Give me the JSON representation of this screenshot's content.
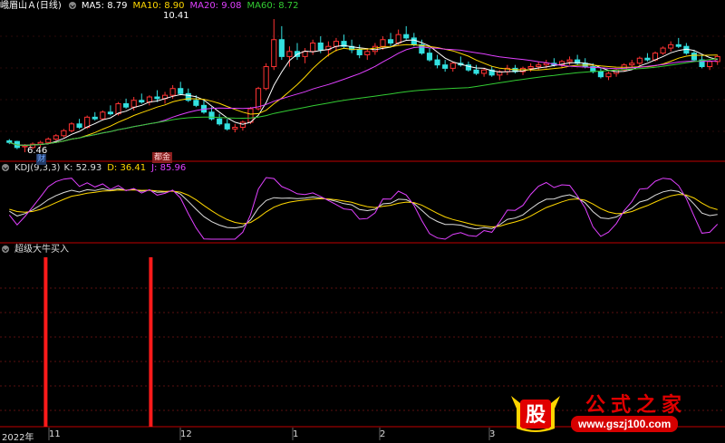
{
  "stock": {
    "name": "峨眉山Ａ(日线)"
  },
  "ma_legend": [
    {
      "label": "MA5: 8.79",
      "color": "#ffffff"
    },
    {
      "label": "MA10: 8.90",
      "color": "#ffd700"
    },
    {
      "label": "MA20: 9.08",
      "color": "#e040ff"
    },
    {
      "label": "MA60: 8.72",
      "color": "#33cc33"
    }
  ],
  "kdj_legend": {
    "label": "KDJ(9,3,3)",
    "k": "K: 52.93",
    "k_color": "#dddddd",
    "d": "D: 36.41",
    "d_color": "#ffd700",
    "j": "J: 85.96",
    "j_color": "#e040ff"
  },
  "signal_panel": {
    "label": "超级大牛买入"
  },
  "annotations": {
    "high": "10.41",
    "low": "6.46",
    "low_tag": "财",
    "event_tag": "都金"
  },
  "timeline": {
    "year": "2022年",
    "ticks": [
      "11",
      "12",
      "1",
      "2",
      "3"
    ]
  },
  "watermark": {
    "badge": "股",
    "title": "公式之家",
    "url": "www.gszj100.com"
  },
  "chart_data": {
    "type": "candlestick",
    "price_range": [
      6.3,
      10.6
    ],
    "candles": [
      [
        6.8,
        6.85,
        6.7,
        6.75
      ],
      [
        6.78,
        6.8,
        6.55,
        6.6
      ],
      [
        6.62,
        6.7,
        6.46,
        6.65
      ],
      [
        6.6,
        6.75,
        6.55,
        6.7
      ],
      [
        6.7,
        6.8,
        6.6,
        6.75
      ],
      [
        6.75,
        6.9,
        6.7,
        6.85
      ],
      [
        6.85,
        7.0,
        6.8,
        6.95
      ],
      [
        6.95,
        7.15,
        6.9,
        7.1
      ],
      [
        7.1,
        7.35,
        7.05,
        7.3
      ],
      [
        7.3,
        7.45,
        7.15,
        7.2
      ],
      [
        7.2,
        7.55,
        7.15,
        7.5
      ],
      [
        7.5,
        7.65,
        7.4,
        7.45
      ],
      [
        7.45,
        7.7,
        7.4,
        7.65
      ],
      [
        7.65,
        7.85,
        7.55,
        7.6
      ],
      [
        7.6,
        7.95,
        7.55,
        7.9
      ],
      [
        7.9,
        8.05,
        7.75,
        7.8
      ],
      [
        7.8,
        8.1,
        7.7,
        8.0
      ],
      [
        8.0,
        8.2,
        7.9,
        7.95
      ],
      [
        7.95,
        8.15,
        7.85,
        8.1
      ],
      [
        8.1,
        8.3,
        7.95,
        8.05
      ],
      [
        8.05,
        8.25,
        7.9,
        8.15
      ],
      [
        8.15,
        8.45,
        8.05,
        8.35
      ],
      [
        8.35,
        8.55,
        8.15,
        8.2
      ],
      [
        8.2,
        8.35,
        7.95,
        8.0
      ],
      [
        8.0,
        8.15,
        7.8,
        7.85
      ],
      [
        7.85,
        8.0,
        7.6,
        7.65
      ],
      [
        7.65,
        7.8,
        7.4,
        7.45
      ],
      [
        7.45,
        7.6,
        7.25,
        7.3
      ],
      [
        7.3,
        7.45,
        7.1,
        7.15
      ],
      [
        7.15,
        7.3,
        7.05,
        7.2
      ],
      [
        7.2,
        7.4,
        7.1,
        7.35
      ],
      [
        7.35,
        7.8,
        7.3,
        7.75
      ],
      [
        7.75,
        8.4,
        7.7,
        8.35
      ],
      [
        8.35,
        9.1,
        8.3,
        9.0
      ],
      [
        9.0,
        10.41,
        8.9,
        9.8
      ],
      [
        9.8,
        10.2,
        9.2,
        9.3
      ],
      [
        9.3,
        9.6,
        9.0,
        9.45
      ],
      [
        9.45,
        9.7,
        9.2,
        9.3
      ],
      [
        9.3,
        9.55,
        9.1,
        9.45
      ],
      [
        9.45,
        9.8,
        9.35,
        9.7
      ],
      [
        9.7,
        9.9,
        9.4,
        9.5
      ],
      [
        9.5,
        9.75,
        9.3,
        9.6
      ],
      [
        9.6,
        9.85,
        9.45,
        9.75
      ],
      [
        9.75,
        9.95,
        9.55,
        9.6
      ],
      [
        9.6,
        9.8,
        9.4,
        9.5
      ],
      [
        9.5,
        9.65,
        9.25,
        9.35
      ],
      [
        9.35,
        9.55,
        9.2,
        9.45
      ],
      [
        9.45,
        9.7,
        9.35,
        9.6
      ],
      [
        9.6,
        9.9,
        9.5,
        9.8
      ],
      [
        9.8,
        10.0,
        9.6,
        9.7
      ],
      [
        9.7,
        10.1,
        9.65,
        9.95
      ],
      [
        9.95,
        10.2,
        9.8,
        9.85
      ],
      [
        9.85,
        10.0,
        9.6,
        9.65
      ],
      [
        9.65,
        9.8,
        9.35,
        9.4
      ],
      [
        9.4,
        9.55,
        9.15,
        9.2
      ],
      [
        9.2,
        9.35,
        8.95,
        9.05
      ],
      [
        9.05,
        9.2,
        8.85,
        8.95
      ],
      [
        8.95,
        9.15,
        8.85,
        9.1
      ],
      [
        9.1,
        9.3,
        9.0,
        9.05
      ],
      [
        9.05,
        9.15,
        8.85,
        8.9
      ],
      [
        8.9,
        9.05,
        8.75,
        8.8
      ],
      [
        8.8,
        8.95,
        8.7,
        8.9
      ],
      [
        8.9,
        9.0,
        8.7,
        8.75
      ],
      [
        8.75,
        8.9,
        8.6,
        8.85
      ],
      [
        8.85,
        9.05,
        8.75,
        8.95
      ],
      [
        8.95,
        9.05,
        8.8,
        8.85
      ],
      [
        8.85,
        9.0,
        8.75,
        8.95
      ],
      [
        8.95,
        9.1,
        8.85,
        9.0
      ],
      [
        9.0,
        9.15,
        8.9,
        9.05
      ],
      [
        9.05,
        9.2,
        8.95,
        9.1
      ],
      [
        9.1,
        9.25,
        9.0,
        9.05
      ],
      [
        9.05,
        9.2,
        8.95,
        9.15
      ],
      [
        9.15,
        9.3,
        9.05,
        9.2
      ],
      [
        9.2,
        9.35,
        9.05,
        9.1
      ],
      [
        9.1,
        9.25,
        8.95,
        9.0
      ],
      [
        9.0,
        9.1,
        8.8,
        8.85
      ],
      [
        8.85,
        8.95,
        8.65,
        8.7
      ],
      [
        8.7,
        8.85,
        8.6,
        8.8
      ],
      [
        8.8,
        8.95,
        8.7,
        8.9
      ],
      [
        8.9,
        9.1,
        8.85,
        9.05
      ],
      [
        9.05,
        9.2,
        8.95,
        9.1
      ],
      [
        9.1,
        9.3,
        9.05,
        9.25
      ],
      [
        9.25,
        9.4,
        9.15,
        9.2
      ],
      [
        9.2,
        9.45,
        9.15,
        9.4
      ],
      [
        9.4,
        9.6,
        9.35,
        9.55
      ],
      [
        9.55,
        9.75,
        9.45,
        9.65
      ],
      [
        9.65,
        9.85,
        9.55,
        9.6
      ],
      [
        9.6,
        9.7,
        9.35,
        9.4
      ],
      [
        9.4,
        9.5,
        9.15,
        9.2
      ],
      [
        9.2,
        9.35,
        8.95,
        9.0
      ],
      [
        9.0,
        9.2,
        8.9,
        9.15
      ],
      [
        9.15,
        9.35,
        9.05,
        9.3
      ]
    ],
    "signals": [
      0.063,
      0.208
    ]
  }
}
